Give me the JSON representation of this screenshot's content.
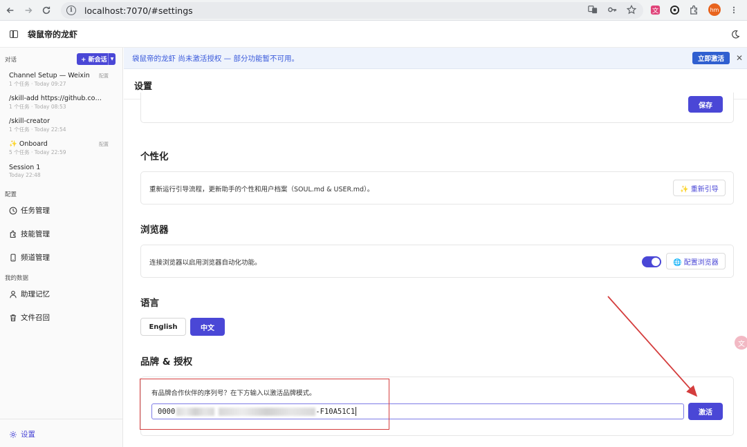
{
  "browser": {
    "url": "localhost:7070/#settings",
    "profile_initials": "hm"
  },
  "app": {
    "title": "袋鼠帝的龙虾"
  },
  "sidebar": {
    "conversations_label": "对话",
    "new_chat_label": "+ 新会话",
    "conversations": [
      {
        "title": "Channel Setup — Weixin",
        "meta": "1 个任务 · Today 09:27",
        "tag": "配置"
      },
      {
        "title": "/skill-add https://github.com/...",
        "meta": "1 个任务 · Today 08:53",
        "tag": ""
      },
      {
        "title": "/skill-creator",
        "meta": "1 个任务 · Today 22:54",
        "tag": ""
      },
      {
        "title": "✨ Onboard",
        "meta": "5 个任务 · Today 22:59",
        "tag": "配置"
      },
      {
        "title": "Session 1",
        "meta": "Today 22:48",
        "tag": ""
      }
    ],
    "config_label": "配置",
    "config_items": [
      "任务管理",
      "技能管理",
      "频道管理"
    ],
    "data_label": "我的数据",
    "data_items": [
      "助理记忆",
      "文件召回"
    ],
    "settings_label": "设置"
  },
  "banner": {
    "message": "袋鼠帝的龙虾 尚未激活授权 — 部分功能暂不可用。",
    "activate_label": "立即激活",
    "close_symbol": "✕"
  },
  "main": {
    "title": "设置",
    "save_label": "保存",
    "personalization": {
      "heading": "个性化",
      "description": "重新运行引导流程，更新助手的个性和用户档案（SOUL.md & USER.md）。",
      "button_label": "✨ 重新引导"
    },
    "browser": {
      "heading": "浏览器",
      "description": "连接浏览器以启用浏览器自动化功能。",
      "toggle_on": true,
      "button_label": "🌐 配置浏览器"
    },
    "language": {
      "heading": "语言",
      "options": [
        "English",
        "中文"
      ],
      "selected": "中文"
    },
    "branding": {
      "heading": "品牌 & 授权",
      "prompt": "有品牌合作伙伴的序列号？在下方输入以激活品牌模式。",
      "serial_prefix": "0000",
      "serial_suffix": "-F10A51C1",
      "activate_label": "激活"
    }
  },
  "colors": {
    "accent": "#4a47d6",
    "banner_bg": "#eef3fc",
    "annotation_red": "#d43d3d"
  }
}
